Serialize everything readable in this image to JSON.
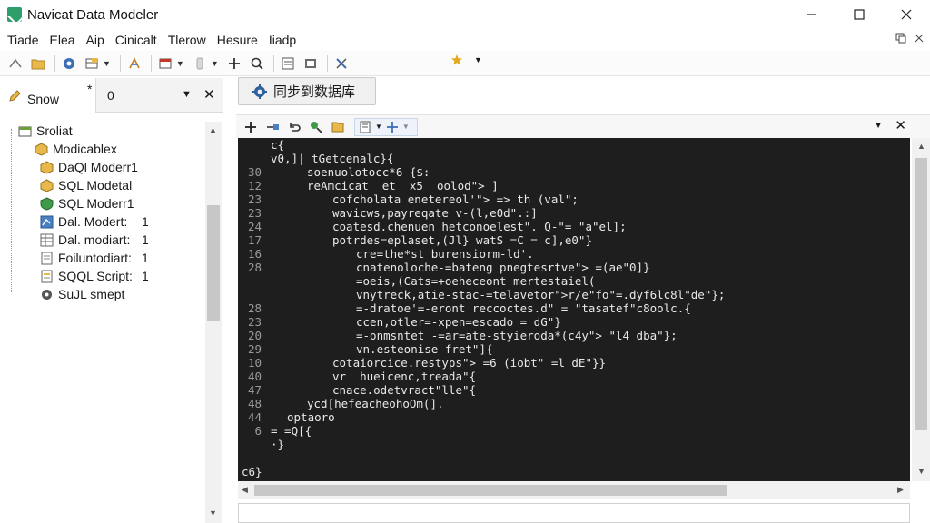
{
  "window": {
    "title": "Navicat Data Modeler",
    "minimize": "—",
    "maximize": "☐",
    "close": "✕"
  },
  "menu": {
    "items": [
      "Tiade",
      "Elea",
      "Aip",
      "Cinicalt",
      "Tlerow",
      "Hesure",
      "Iiadp"
    ]
  },
  "left_panel": {
    "tab_active": "Snow",
    "tab_star": "*",
    "tab_second": "0",
    "tab_caret": "▼",
    "tab_close": "✕",
    "tree": {
      "root": "Sroliat",
      "items": [
        {
          "label": "Modicablex",
          "count": ""
        },
        {
          "label": "DaQl Moderr1",
          "count": ""
        },
        {
          "label": "SQL Modetal",
          "count": ""
        },
        {
          "label": "SQL Moderr1",
          "count": ""
        },
        {
          "label": "Dal. Modert:",
          "count": "1"
        },
        {
          "label": "Dal. modiart:",
          "count": "1"
        },
        {
          "label": "Foiluntodiart:",
          "count": "1"
        },
        {
          "label": "SQQL Script:",
          "count": "1"
        },
        {
          "label": "SuJL smept",
          "count": ""
        }
      ]
    }
  },
  "sync_button": {
    "label": "同步到数据库"
  },
  "editor": {
    "close": "✕",
    "lines": [
      {
        "n": "",
        "indent": 36,
        "text": "c{"
      },
      {
        "n": "",
        "indent": 36,
        "text": "v0,]| tGetcenalc}{"
      },
      {
        "n": "30",
        "indent": 76,
        "text": "soenuolotocc*6 {$:"
      },
      {
        "n": "12",
        "indent": 76,
        "text": "reAmcicat  et  x5  oolod\"> ]"
      },
      {
        "n": "23",
        "indent": 104,
        "text": "cofcholata enetereol'\"> => th (val\";"
      },
      {
        "n": "23",
        "indent": 104,
        "text": "wavicws,payreqate v-(l,e0d\".:]"
      },
      {
        "n": "24",
        "indent": 104,
        "text": "coatesd.chenuen hetconoelest\". Q-\"= \"a\"el];"
      },
      {
        "n": "17",
        "indent": 104,
        "text": "potrdes=eplaset,(Jl} watS =C = c],e0\"}"
      },
      {
        "n": "16",
        "indent": 130,
        "text": "cre=the*st burensiorm-ld'."
      },
      {
        "n": "28",
        "indent": 130,
        "text": "cnatenoloche-=bateng pnegtesrtve\"> =(ae\"0]}"
      },
      {
        "n": "",
        "indent": 130,
        "text": "=oeis,(Cats=+oeheceont mertestaiel("
      },
      {
        "n": "",
        "indent": 130,
        "text": "vnytreck,atie-stac-=telavetor\">r/e\"fo\"=.dyf6lc8l\"de\"};"
      },
      {
        "n": "28",
        "indent": 130,
        "text": "=-dratoe'=-eront reccoctes.d\" = \"tasatef\"c8oolc.{"
      },
      {
        "n": "23",
        "indent": 130,
        "text": "ccen,otler=-xpen=escado = dG\"}"
      },
      {
        "n": "20",
        "indent": 130,
        "text": "=-onmsntet -=ar=ate-styieroda*(c4y\"> \"l4 dba\"};"
      },
      {
        "n": "29",
        "indent": 130,
        "text": "vn.esteonise-fret\"]{"
      },
      {
        "n": "10",
        "indent": 104,
        "text": "cotaiorcice.restyps\"> =6 (iobt\" =l dE\"}}"
      },
      {
        "n": "40",
        "indent": 104,
        "text": "vr  hueicenc,treada\"{"
      },
      {
        "n": "47",
        "indent": 104,
        "text": "cnace.odetvract\"lle\"{"
      },
      {
        "n": "48",
        "indent": 76,
        "text": "ycd[hefeacheohoOm(]."
      },
      {
        "n": "44",
        "indent": 54,
        "text": "optaoro"
      },
      {
        "n": "6",
        "indent": 36,
        "text": "= =Q[{"
      },
      {
        "n": "",
        "indent": 36,
        "text": "·}"
      },
      {
        "n": "",
        "indent": 4,
        "text": ""
      },
      {
        "n": "",
        "indent": 4,
        "text": "c6}"
      }
    ]
  },
  "colors": {
    "code_bg": "#1e1e1e",
    "code_text": "#e8e8e8",
    "line_number": "#9a9a9a",
    "app_icon": "#2e9e6a"
  }
}
